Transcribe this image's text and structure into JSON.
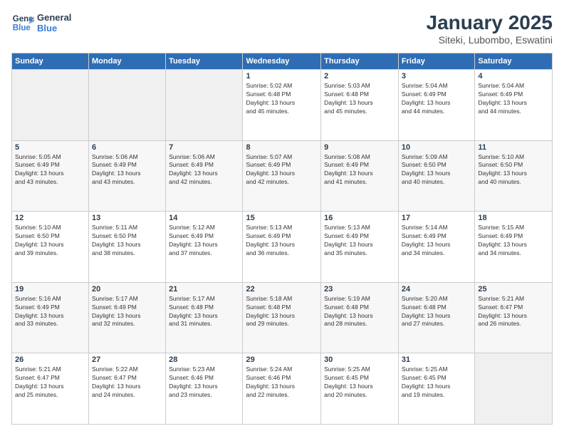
{
  "logo": {
    "line1": "General",
    "line2": "Blue"
  },
  "title": "January 2025",
  "subtitle": "Siteki, Lubombo, Eswatini",
  "days_of_week": [
    "Sunday",
    "Monday",
    "Tuesday",
    "Wednesday",
    "Thursday",
    "Friday",
    "Saturday"
  ],
  "weeks": [
    [
      {
        "day": "",
        "info": ""
      },
      {
        "day": "",
        "info": ""
      },
      {
        "day": "",
        "info": ""
      },
      {
        "day": "1",
        "info": "Sunrise: 5:02 AM\nSunset: 6:48 PM\nDaylight: 13 hours\nand 45 minutes."
      },
      {
        "day": "2",
        "info": "Sunrise: 5:03 AM\nSunset: 6:48 PM\nDaylight: 13 hours\nand 45 minutes."
      },
      {
        "day": "3",
        "info": "Sunrise: 5:04 AM\nSunset: 6:49 PM\nDaylight: 13 hours\nand 44 minutes."
      },
      {
        "day": "4",
        "info": "Sunrise: 5:04 AM\nSunset: 6:49 PM\nDaylight: 13 hours\nand 44 minutes."
      }
    ],
    [
      {
        "day": "5",
        "info": "Sunrise: 5:05 AM\nSunset: 6:49 PM\nDaylight: 13 hours\nand 43 minutes."
      },
      {
        "day": "6",
        "info": "Sunrise: 5:06 AM\nSunset: 6:49 PM\nDaylight: 13 hours\nand 43 minutes."
      },
      {
        "day": "7",
        "info": "Sunrise: 5:06 AM\nSunset: 6:49 PM\nDaylight: 13 hours\nand 42 minutes."
      },
      {
        "day": "8",
        "info": "Sunrise: 5:07 AM\nSunset: 6:49 PM\nDaylight: 13 hours\nand 42 minutes."
      },
      {
        "day": "9",
        "info": "Sunrise: 5:08 AM\nSunset: 6:49 PM\nDaylight: 13 hours\nand 41 minutes."
      },
      {
        "day": "10",
        "info": "Sunrise: 5:09 AM\nSunset: 6:50 PM\nDaylight: 13 hours\nand 40 minutes."
      },
      {
        "day": "11",
        "info": "Sunrise: 5:10 AM\nSunset: 6:50 PM\nDaylight: 13 hours\nand 40 minutes."
      }
    ],
    [
      {
        "day": "12",
        "info": "Sunrise: 5:10 AM\nSunset: 6:50 PM\nDaylight: 13 hours\nand 39 minutes."
      },
      {
        "day": "13",
        "info": "Sunrise: 5:11 AM\nSunset: 6:50 PM\nDaylight: 13 hours\nand 38 minutes."
      },
      {
        "day": "14",
        "info": "Sunrise: 5:12 AM\nSunset: 6:49 PM\nDaylight: 13 hours\nand 37 minutes."
      },
      {
        "day": "15",
        "info": "Sunrise: 5:13 AM\nSunset: 6:49 PM\nDaylight: 13 hours\nand 36 minutes."
      },
      {
        "day": "16",
        "info": "Sunrise: 5:13 AM\nSunset: 6:49 PM\nDaylight: 13 hours\nand 35 minutes."
      },
      {
        "day": "17",
        "info": "Sunrise: 5:14 AM\nSunset: 6:49 PM\nDaylight: 13 hours\nand 34 minutes."
      },
      {
        "day": "18",
        "info": "Sunrise: 5:15 AM\nSunset: 6:49 PM\nDaylight: 13 hours\nand 34 minutes."
      }
    ],
    [
      {
        "day": "19",
        "info": "Sunrise: 5:16 AM\nSunset: 6:49 PM\nDaylight: 13 hours\nand 33 minutes."
      },
      {
        "day": "20",
        "info": "Sunrise: 5:17 AM\nSunset: 6:49 PM\nDaylight: 13 hours\nand 32 minutes."
      },
      {
        "day": "21",
        "info": "Sunrise: 5:17 AM\nSunset: 6:48 PM\nDaylight: 13 hours\nand 31 minutes."
      },
      {
        "day": "22",
        "info": "Sunrise: 5:18 AM\nSunset: 6:48 PM\nDaylight: 13 hours\nand 29 minutes."
      },
      {
        "day": "23",
        "info": "Sunrise: 5:19 AM\nSunset: 6:48 PM\nDaylight: 13 hours\nand 28 minutes."
      },
      {
        "day": "24",
        "info": "Sunrise: 5:20 AM\nSunset: 6:48 PM\nDaylight: 13 hours\nand 27 minutes."
      },
      {
        "day": "25",
        "info": "Sunrise: 5:21 AM\nSunset: 6:47 PM\nDaylight: 13 hours\nand 26 minutes."
      }
    ],
    [
      {
        "day": "26",
        "info": "Sunrise: 5:21 AM\nSunset: 6:47 PM\nDaylight: 13 hours\nand 25 minutes."
      },
      {
        "day": "27",
        "info": "Sunrise: 5:22 AM\nSunset: 6:47 PM\nDaylight: 13 hours\nand 24 minutes."
      },
      {
        "day": "28",
        "info": "Sunrise: 5:23 AM\nSunset: 6:46 PM\nDaylight: 13 hours\nand 23 minutes."
      },
      {
        "day": "29",
        "info": "Sunrise: 5:24 AM\nSunset: 6:46 PM\nDaylight: 13 hours\nand 22 minutes."
      },
      {
        "day": "30",
        "info": "Sunrise: 5:25 AM\nSunset: 6:45 PM\nDaylight: 13 hours\nand 20 minutes."
      },
      {
        "day": "31",
        "info": "Sunrise: 5:25 AM\nSunset: 6:45 PM\nDaylight: 13 hours\nand 19 minutes."
      },
      {
        "day": "",
        "info": ""
      }
    ]
  ]
}
